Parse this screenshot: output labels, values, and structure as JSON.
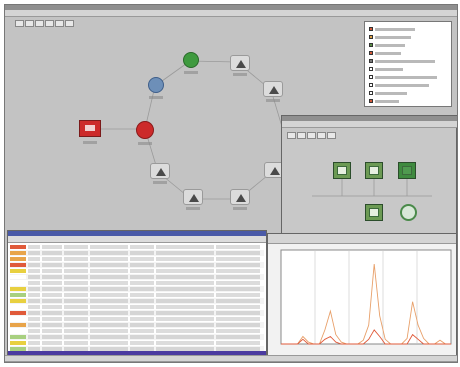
{
  "colors": {
    "desktop": "#c3c3c3",
    "legend_bg": "#ffffff",
    "chart_line": "#e8a06a",
    "status_red": "#cc2a2a",
    "status_green": "#3f9a3f",
    "status_blue": "#6d8fb8"
  },
  "icons": {
    "map_nodes": [
      "router-icon-green",
      "router-icon-blue",
      "router-icon-red",
      "server-icon-red",
      "alert-triangle-icon"
    ],
    "servers": [
      "server-icon",
      "server-icon",
      "server-icon",
      "server-icon",
      "globe-icon"
    ]
  },
  "legend": {
    "items": [
      {
        "swatch": "#d65a3a"
      },
      {
        "swatch": "#e0a44a"
      },
      {
        "swatch": "#5a8f46"
      },
      {
        "swatch": "#d65a3a"
      },
      {
        "swatch": "#7a7a7a"
      },
      {
        "swatch": "#ffffff"
      },
      {
        "swatch": "#ffffff"
      },
      {
        "swatch": "#ffffff"
      },
      {
        "swatch": "#ffffff"
      },
      {
        "swatch": "#d65a3a"
      }
    ]
  },
  "log": {
    "row_colors": [
      "#e05a3a",
      "#e8a44a",
      "#e8a44a",
      "#e05a3a",
      "#e8d040",
      "#ffffff",
      "#ffffff",
      "#e8d040",
      "#a8d080",
      "#e8d040",
      "#ffffff",
      "#e05a3a",
      "#ffffff",
      "#e8a44a",
      "#ffffff",
      "#a8d080",
      "#e8d040",
      "#a8d080"
    ]
  },
  "chart_data": {
    "type": "line",
    "series": [
      {
        "values": [
          0,
          0,
          0,
          0,
          0.08,
          0.02,
          0,
          0,
          0.15,
          0.35,
          0.1,
          0.02,
          0,
          0,
          0,
          0.04,
          0.2,
          0.85,
          0.3,
          0.05,
          0,
          0,
          0,
          0.06,
          0.45,
          0.2,
          0.06,
          0,
          0,
          0.04,
          0,
          0
        ]
      },
      {
        "values": [
          0,
          0,
          0,
          0,
          0.05,
          0,
          0,
          0,
          0.05,
          0.08,
          0.02,
          0,
          0,
          0,
          0,
          0,
          0.05,
          0.15,
          0.08,
          0,
          0,
          0,
          0,
          0,
          0.1,
          0.05,
          0,
          0,
          0,
          0,
          0,
          0
        ]
      }
    ],
    "ylim": [
      0,
      1
    ],
    "grid": true
  }
}
